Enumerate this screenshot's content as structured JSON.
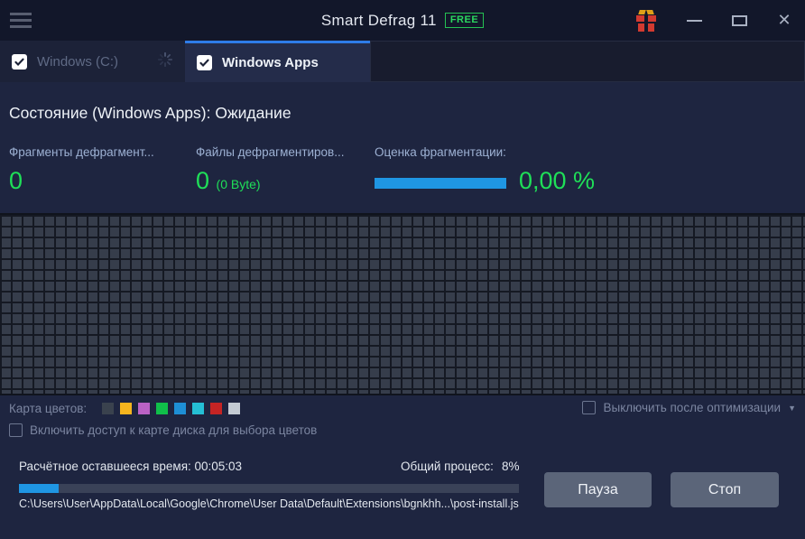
{
  "titlebar": {
    "title": "Smart Defrag 11",
    "badge": "FREE",
    "icons": {
      "close_glyph": "✕",
      "dropdown_glyph": "▼"
    }
  },
  "tabs": [
    {
      "label": "Windows (C:)",
      "checked": true,
      "active": false,
      "busy": true
    },
    {
      "label": "Windows Apps",
      "checked": true,
      "active": true
    }
  ],
  "status_heading": "Состояние (Windows Apps): Ожидание",
  "stats": {
    "fragments": {
      "label": "Фрагменты дефрагмент...",
      "value": "0"
    },
    "files": {
      "label": "Файлы дефрагментиров...",
      "value": "0",
      "suffix": "(0 Byte)"
    },
    "fragmentation": {
      "label": "Оценка фрагментации:",
      "value": "0,00 %",
      "bar_percent": 100
    }
  },
  "color_map": {
    "label": "Карта цветов:",
    "swatches": [
      "#3a424e",
      "#f6b51e",
      "#ba62c5",
      "#10bf4a",
      "#1e8fd5",
      "#25bfd4",
      "#c52424",
      "#c3cad3"
    ]
  },
  "options": {
    "shutdown": {
      "label": "Выключить после оптимизации",
      "checked": false
    },
    "disk_access": {
      "label": "Включить доступ к карте диска для выбора цветов",
      "checked": false
    }
  },
  "footer": {
    "time_text": "Расчётное оставшееся время: 00:05:03",
    "overall_label": "Общий процесс:",
    "overall_value": "8%",
    "overall_percent": 8,
    "current_file": "C:\\Users\\User\\AppData\\Local\\Google\\Chrome\\User Data\\Default\\Extensions\\bgnkhh...\\post-install.js",
    "pause_label": "Пауза",
    "stop_label": "Стоп"
  },
  "colors": {
    "accent_blue": "#1f96e3",
    "value_green": "#1fdf58",
    "active_tab_border": "#2e7ce8",
    "window_bg": "#1e2540",
    "titlebar_bg": "#12172a"
  }
}
